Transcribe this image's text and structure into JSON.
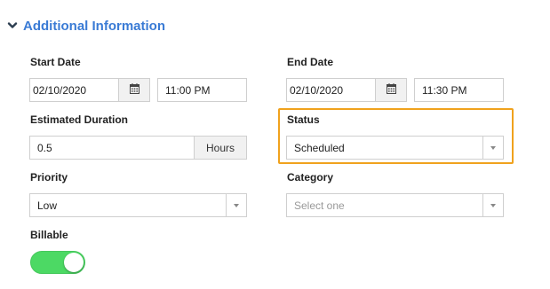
{
  "section": {
    "title": "Additional Information",
    "icon": "chevron-down-icon"
  },
  "start_date": {
    "label": "Start Date",
    "date": "02/10/2020",
    "time": "11:00 PM",
    "icon": "calendar-icon"
  },
  "end_date": {
    "label": "End Date",
    "date": "02/10/2020",
    "time": "11:30 PM",
    "icon": "calendar-icon"
  },
  "estimated_duration": {
    "label": "Estimated Duration",
    "value": "0.5",
    "unit": "Hours"
  },
  "status": {
    "label": "Status",
    "value": "Scheduled",
    "highlight_color": "#f0a21d"
  },
  "priority": {
    "label": "Priority",
    "value": "Low"
  },
  "category": {
    "label": "Category",
    "placeholder": "Select one"
  },
  "billable": {
    "label": "Billable",
    "enabled": true,
    "on_color": "#4cd964"
  },
  "colors": {
    "accent": "#3a7bd5",
    "border": "#cfcfcf"
  }
}
